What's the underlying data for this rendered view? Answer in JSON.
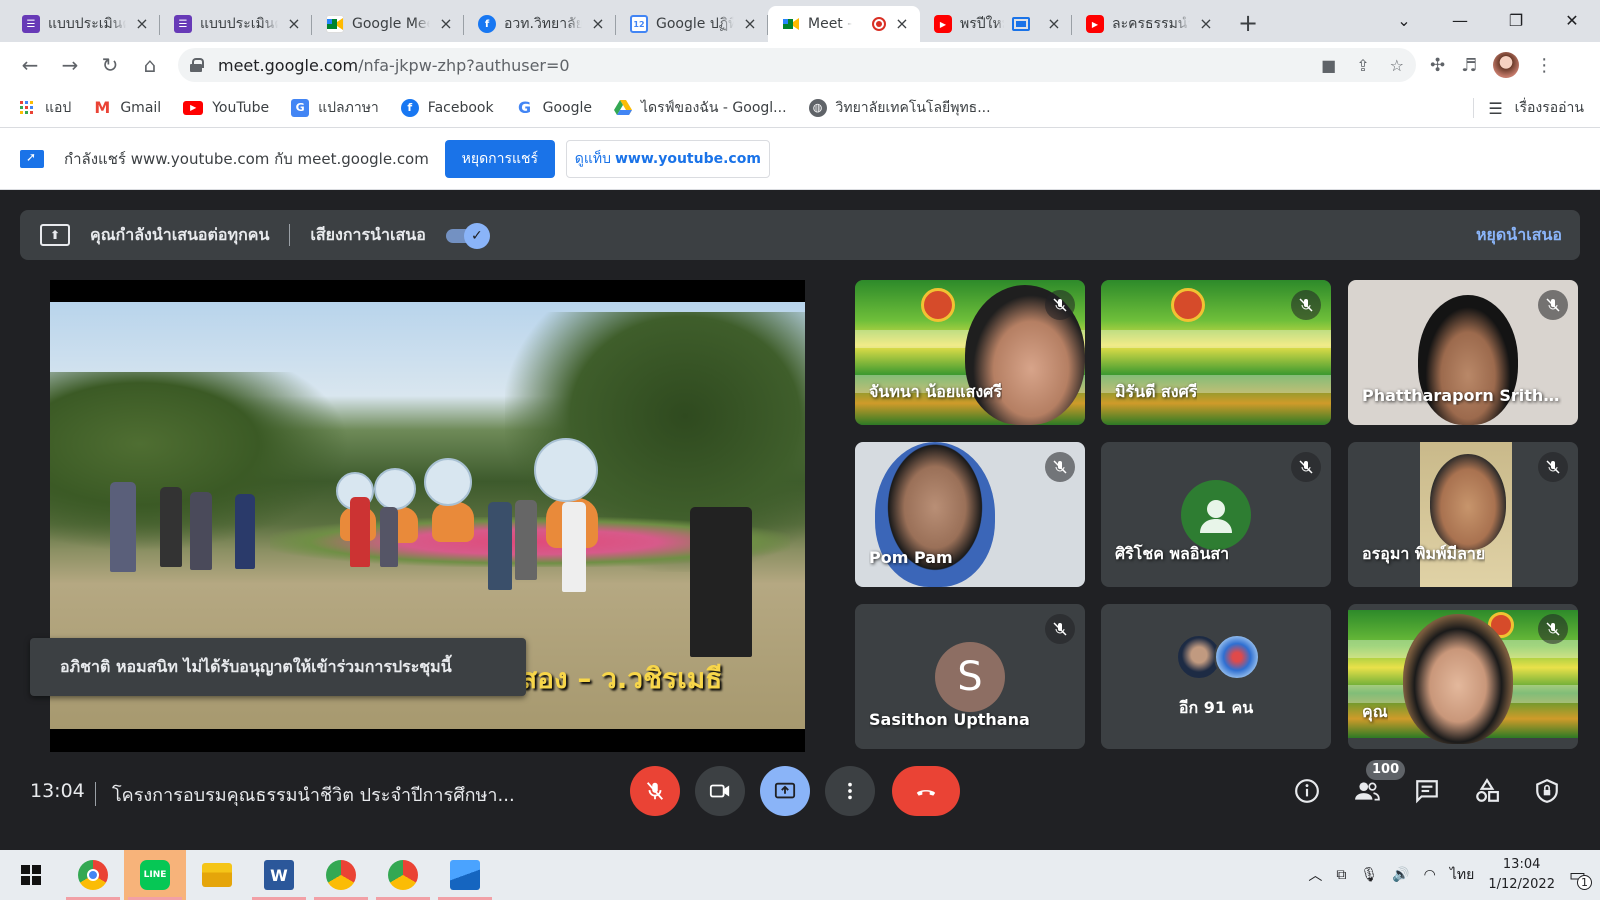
{
  "browser": {
    "tabs": [
      {
        "title": "แบบประเมินค",
        "icon": "forms-icon",
        "color": "#673ab7",
        "active": false
      },
      {
        "title": "แบบประเมินค",
        "icon": "forms-icon",
        "color": "#673ab7",
        "active": false
      },
      {
        "title": "Google Meet",
        "icon": "meet-icon",
        "color": "#00897b",
        "active": false
      },
      {
        "title": "อวท.วิทยาลัย",
        "icon": "facebook-icon",
        "color": "#1877f2",
        "active": false
      },
      {
        "title": "Google ปฏิทิน",
        "icon": "calendar-icon",
        "color": "#4285f4",
        "active": false
      },
      {
        "title": "Meet -",
        "icon": "meet-icon",
        "color": "#00897b",
        "active": true,
        "recording": true
      },
      {
        "title": "พรปีใหม่",
        "icon": "youtube-icon",
        "color": "#ff0000",
        "active": false,
        "casting": true
      },
      {
        "title": "ละครธรรมนำ",
        "icon": "youtube-icon",
        "color": "#ff0000",
        "active": false
      }
    ],
    "url_host": "meet.google.com",
    "url_path": "/nfa-jkpw-zhp?authuser=0",
    "bookmarks": [
      {
        "label": "แอป",
        "icon": "apps-grid-icon"
      },
      {
        "label": "Gmail",
        "icon": "gmail-icon"
      },
      {
        "label": "YouTube",
        "icon": "youtube-icon"
      },
      {
        "label": "แปลภาษา",
        "icon": "translate-icon"
      },
      {
        "label": "Facebook",
        "icon": "facebook-icon"
      },
      {
        "label": "Google",
        "icon": "google-icon"
      },
      {
        "label": "ไดรฟ์ของฉัน - Googl...",
        "icon": "drive-icon"
      },
      {
        "label": "วิทยาลัยเทคโนโลยีพุทธ...",
        "icon": "globe-icon"
      }
    ],
    "reading_list": "เรื่องรออ่าน"
  },
  "infobar": {
    "text": "กำลังแชร์ www.youtube.com กับ meet.google.com",
    "stop_label": "หยุดการแชร์",
    "switch_prefix": "ดูแท็บ",
    "switch_host": "www.youtube.com"
  },
  "meet": {
    "banner_text": "คุณกำลังนำเสนอต่อทุกคน",
    "audio_label": "เสียงการนำเสนอ",
    "audio_on": true,
    "stop_present": "หยุดนำเสนอ",
    "video_caption": "สอง – ว.วชิรเมธี",
    "toast": "อภิชาติ หอมสนิท ไม่ได้รับอนุญาตให้เข้าร่วมการประชุมนี้",
    "participants": [
      {
        "name": "จันทนา น้อยแสงศรี",
        "type": "banner-video",
        "muted": true
      },
      {
        "name": "มิรันตี สงศรี",
        "type": "banner-video",
        "muted": true
      },
      {
        "name": "Phattharaporn Sritha...",
        "type": "video",
        "muted": true
      },
      {
        "name": "Pom Pam",
        "type": "video",
        "muted": true
      },
      {
        "name": "ศิริโชค พลอินสา",
        "type": "avatar",
        "muted": true
      },
      {
        "name": "อรอุมา พิมพ์มีลาย",
        "type": "video",
        "muted": true
      },
      {
        "name": "Sasithon Upthana",
        "type": "letter",
        "letter": "S",
        "muted": true
      },
      {
        "name": "อีก 91 คน",
        "type": "more"
      },
      {
        "name": "คุณ",
        "type": "self",
        "muted": true
      }
    ],
    "clock": "13:04",
    "meeting_title": "โครงการอบรมคุณธรรมนำชีวิต ประจำปีการศึกษา...",
    "people_count": "100"
  },
  "taskbar": {
    "language": "ไทย",
    "time": "13:04",
    "date": "1/12/2022",
    "notification_count": "1"
  },
  "colors": {
    "accent_blue": "#1a73e8",
    "meet_dark": "#202124",
    "meet_tile": "#3c4043",
    "danger_red": "#ea4335",
    "link_blue": "#8ab4f8"
  }
}
